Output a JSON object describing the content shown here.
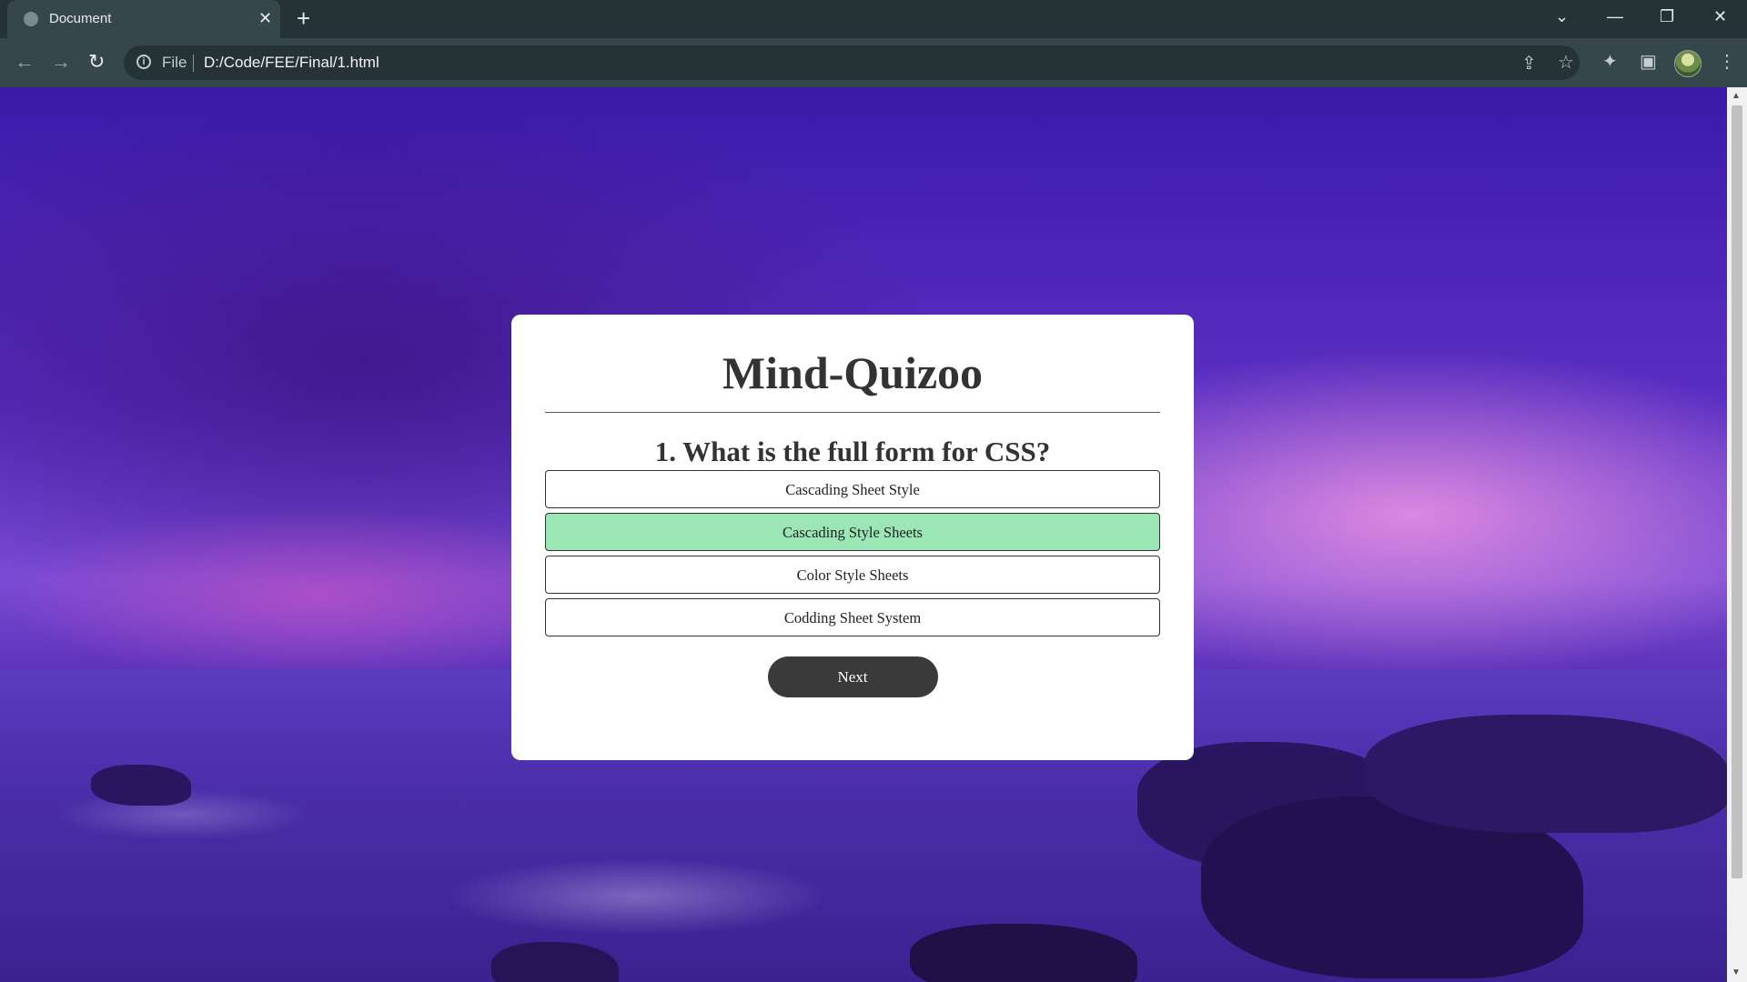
{
  "browser": {
    "tab_title": "Document",
    "tab_close": "✕",
    "new_tab": "+",
    "scheme_label": "File",
    "url": "D:/Code/FEE/Final/1.html"
  },
  "quiz": {
    "title": "Mind-Quizoo",
    "question": "1. What is the full form for CSS?",
    "answers": [
      {
        "label": "Cascading Sheet Style",
        "state": "default"
      },
      {
        "label": "Cascading Style Sheets",
        "state": "correct"
      },
      {
        "label": "Color Style Sheets",
        "state": "default"
      },
      {
        "label": "Codding Sheet System",
        "state": "default"
      }
    ],
    "next_label": "Next",
    "correct_color": "#9ae6b4"
  }
}
